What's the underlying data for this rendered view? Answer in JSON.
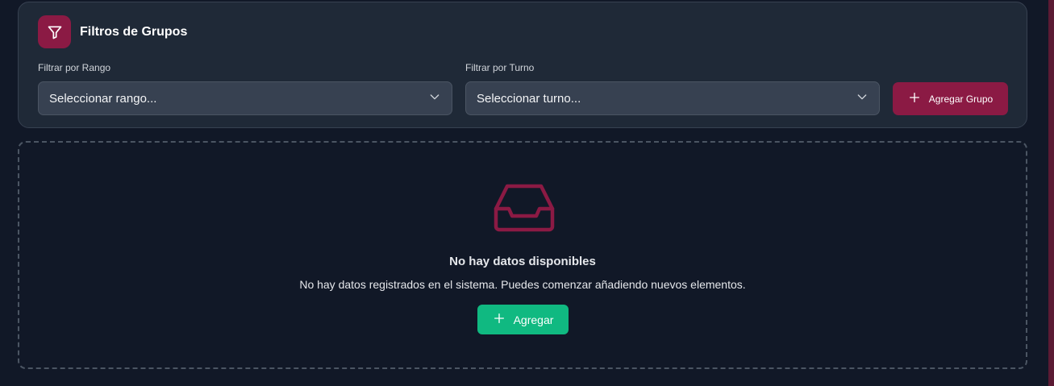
{
  "colors": {
    "background": "#111827",
    "card": "#1f2937",
    "accent": "#8b1a44",
    "success": "#10b981"
  },
  "filters": {
    "title": "Filtros de Grupos",
    "icon": "filter-icon",
    "rango": {
      "label": "Filtrar por Rango",
      "value": "Seleccionar rango..."
    },
    "turno": {
      "label": "Filtrar por Turno",
      "value": "Seleccionar turno..."
    },
    "add_group_label": "Agregar Grupo"
  },
  "empty_state": {
    "icon": "inbox-icon",
    "title": "No hay datos disponibles",
    "description": "No hay datos registrados en el sistema. Puedes comenzar añadiendo nuevos elementos.",
    "add_label": "Agregar"
  }
}
